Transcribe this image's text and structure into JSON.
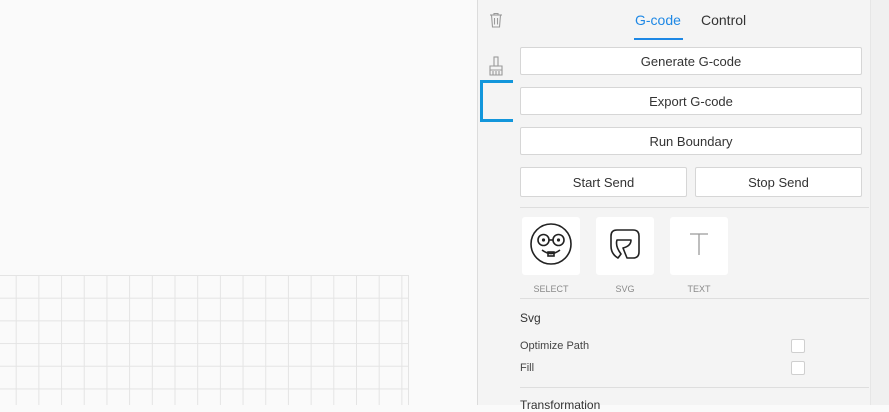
{
  "tabs": [
    {
      "label": "G-code",
      "active": true
    },
    {
      "label": "Control",
      "active": false
    }
  ],
  "toolstrip": {
    "icons": [
      "trash-icon",
      "broom-icon"
    ]
  },
  "actions": {
    "generate": "Generate G-code",
    "export": "Export G-code",
    "run_boundary": "Run Boundary",
    "start_send": "Start Send",
    "stop_send": "Stop Send"
  },
  "modes": [
    {
      "label": "SELECT",
      "icon": "smiley-glasses-icon"
    },
    {
      "label": "SVG",
      "icon": "svg-shape-icon"
    },
    {
      "label": "TEXT",
      "icon": "text-t-icon"
    }
  ],
  "svg_section": {
    "title": "Svg",
    "options": [
      {
        "label": "Optimize Path",
        "checked": false
      },
      {
        "label": "Fill",
        "checked": false
      }
    ]
  },
  "next_section": {
    "title": "Transformation"
  },
  "colors": {
    "accent": "#1e88e5",
    "highlight": "#1296db"
  }
}
